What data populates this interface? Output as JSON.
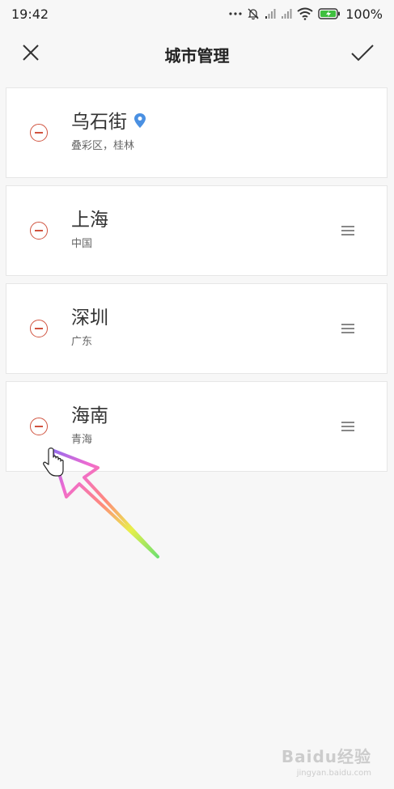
{
  "status_bar": {
    "time": "19:42",
    "battery_percent": "100%",
    "icons": [
      "more-dots-icon",
      "mute-bell-icon",
      "signal-icon",
      "signal-icon",
      "wifi-icon",
      "battery-charging-icon"
    ]
  },
  "header": {
    "title": "城市管理",
    "close_icon": "close-icon",
    "confirm_icon": "checkmark-icon"
  },
  "cities": [
    {
      "name": "乌石街",
      "region": "叠彩区，桂林",
      "current_location": true,
      "draggable": false
    },
    {
      "name": "上海",
      "region": "中国",
      "current_location": false,
      "draggable": true
    },
    {
      "name": "深圳",
      "region": "广东",
      "current_location": false,
      "draggable": true
    },
    {
      "name": "海南",
      "region": "青海",
      "current_location": false,
      "draggable": true
    }
  ],
  "colors": {
    "background": "#f7f7f7",
    "card": "#ffffff",
    "remove_red": "#d0533f",
    "location_blue": "#4a90e2"
  },
  "watermark": {
    "main": "Baidu经验",
    "sub": "jingyan.baidu.com"
  }
}
